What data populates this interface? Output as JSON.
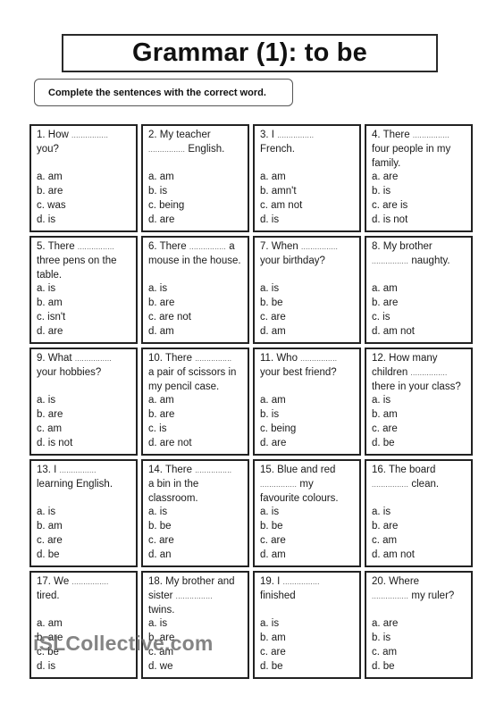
{
  "worksheet": {
    "title": "Grammar (1): to be",
    "instruction": "Complete the sentences with the correct word.",
    "watermark": "iSLCollective.com",
    "questions": [
      {
        "lines": [
          "1. How ................",
          "you?"
        ],
        "options": [
          "a. am",
          "b. are",
          "c. was",
          "d. is"
        ]
      },
      {
        "lines": [
          "2. My teacher",
          "................ English."
        ],
        "options": [
          "a. am",
          "b. is",
          "c. being",
          "d. are"
        ]
      },
      {
        "lines": [
          "3. I ................",
          "French."
        ],
        "options": [
          "a. am",
          "b. amn't",
          "c. am not",
          "d. is"
        ]
      },
      {
        "lines": [
          "4. There ................",
          "four people in my",
          "family."
        ],
        "options": [
          "a. are",
          "b. is",
          "c. are is",
          "d. is not"
        ]
      },
      {
        "lines": [
          "5. There ................",
          "three pens on the",
          "table."
        ],
        "options": [
          "a. is",
          "b. am",
          "c. isn't",
          "d. are"
        ]
      },
      {
        "lines": [
          "6. There ................ a",
          "mouse in the house."
        ],
        "options": [
          "a. is",
          "b. are",
          "c. are not",
          "d. am"
        ]
      },
      {
        "lines": [
          "7. When ................",
          "your birthday?"
        ],
        "options": [
          "a. is",
          "b. be",
          "c. are",
          "d. am"
        ]
      },
      {
        "lines": [
          "8. My brother",
          "................ naughty."
        ],
        "options": [
          "a. am",
          "b. are",
          "c. is",
          "d. am not"
        ]
      },
      {
        "lines": [
          "9. What ................",
          "your hobbies?"
        ],
        "options": [
          "a. is",
          "b. are",
          "c. am",
          "d. is not"
        ]
      },
      {
        "lines": [
          "10. There ................",
          "a pair of scissors in",
          "my pencil case."
        ],
        "options": [
          "a. am",
          "b. are",
          "c. is",
          "d. are not"
        ]
      },
      {
        "lines": [
          "11. Who ................",
          "your best friend?"
        ],
        "options": [
          "a. am",
          "b. is",
          "c. being",
          "d. are"
        ]
      },
      {
        "lines": [
          "12. How many",
          "children ................",
          "there in your class?"
        ],
        "options": [
          "a. is",
          "b. am",
          "c. are",
          "d. be"
        ]
      },
      {
        "lines": [
          "13. I ................",
          "learning English."
        ],
        "options": [
          "a. is",
          "b. am",
          "c. are",
          "d. be"
        ]
      },
      {
        "lines": [
          "14. There ................",
          "a bin in the",
          "classroom."
        ],
        "options": [
          "a. is",
          "b. be",
          "c. are",
          "d. an"
        ]
      },
      {
        "lines": [
          "15. Blue and red",
          "................ my",
          "favourite colours."
        ],
        "options": [
          "a. is",
          "b. be",
          "c. are",
          "d. am"
        ]
      },
      {
        "lines": [
          "16. The board",
          "................ clean."
        ],
        "options": [
          "a. is",
          "b. are",
          "c. am",
          "d. am not"
        ]
      },
      {
        "lines": [
          "17. We ................",
          "tired."
        ],
        "options": [
          "a. am",
          "b. are",
          "c. be",
          "d. is"
        ]
      },
      {
        "lines": [
          "18. My brother and",
          "sister ................",
          "twins."
        ],
        "options": [
          "a. is",
          "b. are",
          "c. am",
          "d. we"
        ]
      },
      {
        "lines": [
          "19. I ................",
          "finished"
        ],
        "options": [
          "a. is",
          "b. am",
          "c. are",
          "d. be"
        ]
      },
      {
        "lines": [
          "20. Where",
          "................ my ruler?"
        ],
        "options": [
          "a. are",
          "b. is",
          "c. am",
          "d. be"
        ]
      }
    ]
  }
}
